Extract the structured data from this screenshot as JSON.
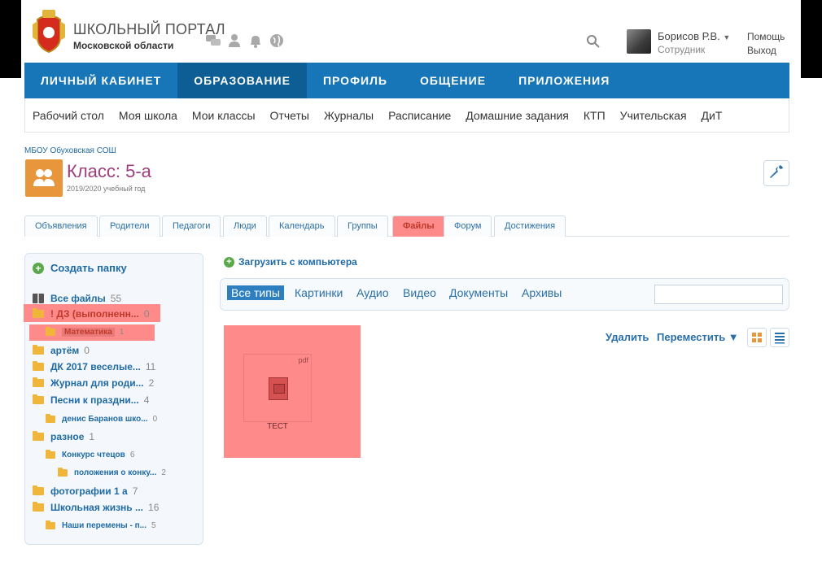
{
  "header": {
    "portal_title": "ШКОЛЬНЫЙ ПОРТАЛ",
    "portal_subtitle": "Московской области",
    "user_name": "Борисов Р.В.",
    "user_role": "Сотрудник",
    "help_label": "Помощь",
    "exit_label": "Выход"
  },
  "main_nav": [
    {
      "label": "ЛИЧНЫЙ КАБИНЕТ"
    },
    {
      "label": "ОБРАЗОВАНИЕ"
    },
    {
      "label": "ПРОФИЛЬ"
    },
    {
      "label": "ОБЩЕНИЕ"
    },
    {
      "label": "ПРИЛОЖЕНИЯ"
    }
  ],
  "sub_nav": [
    {
      "label": "Рабочий стол"
    },
    {
      "label": "Моя школа"
    },
    {
      "label": "Мои классы"
    },
    {
      "label": "Отчеты"
    },
    {
      "label": "Журналы"
    },
    {
      "label": "Расписание"
    },
    {
      "label": "Домашние задания"
    },
    {
      "label": "КТП"
    },
    {
      "label": "Учительская"
    },
    {
      "label": "ДиТ"
    }
  ],
  "page": {
    "breadcrumb": "МБОУ Обуховская СОШ",
    "class_title": "Класс: 5-а",
    "school_year": "2019/2020 учебный год"
  },
  "tabs": [
    {
      "label": "Объявления"
    },
    {
      "label": "Родители"
    },
    {
      "label": "Педагоги"
    },
    {
      "label": "Люди"
    },
    {
      "label": "Календарь"
    },
    {
      "label": "Группы"
    },
    {
      "label": "Файлы"
    },
    {
      "label": "Форум"
    },
    {
      "label": "Достижения"
    }
  ],
  "sidebar": {
    "create_folder_label": "Создать папку",
    "all_files": {
      "label": "Все файлы",
      "count": "55"
    },
    "folders": [
      {
        "label": "! ДЗ (выполненн...",
        "count": "0"
      },
      {
        "label": "Математика",
        "count": "1"
      },
      {
        "label": "артём",
        "count": "0"
      },
      {
        "label": "ДК 2017 веселые...",
        "count": "11"
      },
      {
        "label": "Журнал для роди...",
        "count": "2"
      },
      {
        "label": "Песни к праздни...",
        "count": "4"
      },
      {
        "label": "денис Баранов шко...",
        "count": "0"
      },
      {
        "label": "разное",
        "count": "1"
      },
      {
        "label": "Конкурс чтецов",
        "count": "6"
      },
      {
        "label": "положения о конку...",
        "count": "2"
      },
      {
        "label": "фотографии 1 а",
        "count": "7"
      },
      {
        "label": "Школьная жизнь ...",
        "count": "16"
      },
      {
        "label": "Наши перемены - п...",
        "count": "5"
      }
    ]
  },
  "content": {
    "upload_label": "Загрузить с компьютера",
    "filters": [
      {
        "label": "Все типы"
      },
      {
        "label": "Картинки"
      },
      {
        "label": "Аудио"
      },
      {
        "label": "Видео"
      },
      {
        "label": "Документы"
      },
      {
        "label": "Архивы"
      }
    ],
    "search_value": "",
    "delete_label": "Удалить",
    "move_label": "Переместить ▼",
    "files": [
      {
        "name": "ТЕСТ",
        "ext": "pdf"
      }
    ]
  },
  "colors": {
    "nav_blue": "#1676b8",
    "nav_active": "#0d5e95",
    "link": "#1f6aa5",
    "class_title": "#9e3e7a",
    "highlight": "#ff8a8a"
  },
  "icons": [
    "coat-of-arms-icon",
    "chat-icon",
    "person-icon",
    "bell-icon",
    "globe-icon",
    "search-icon",
    "wrench-icon",
    "plus-icon",
    "folder-icon",
    "gift-icon",
    "pdf-icon",
    "grid-view-icon",
    "list-view-icon"
  ]
}
